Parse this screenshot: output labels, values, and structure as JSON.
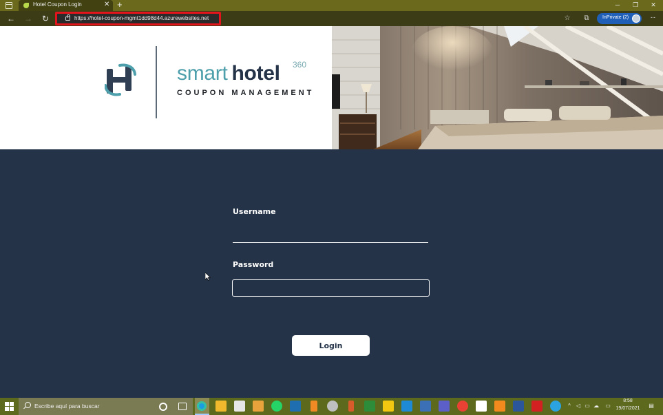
{
  "browser": {
    "tab_title": "Hotel Coupon Login",
    "url": "https://hotel-coupon-mgmt1dd98d44.azurewebsites.net",
    "inprivate_label": "InPrivate (2)"
  },
  "brand": {
    "word1": "smart",
    "word2": "hotel",
    "superscript": "360",
    "subtitle": "COUPON MANAGEMENT"
  },
  "form": {
    "username_label": "Username",
    "username_value": "",
    "password_label": "Password",
    "password_value": "",
    "login_label": "Login"
  },
  "taskbar": {
    "search_placeholder": "Escribe aquí para buscar",
    "time": "8:58",
    "date": "19/07/2021"
  },
  "colors": {
    "page_background": "#243348",
    "brand_teal": "#4d9fab",
    "brand_navy": "#243348",
    "address_highlight": "#e3141b",
    "inprivate_blue": "#1f5fb8"
  }
}
